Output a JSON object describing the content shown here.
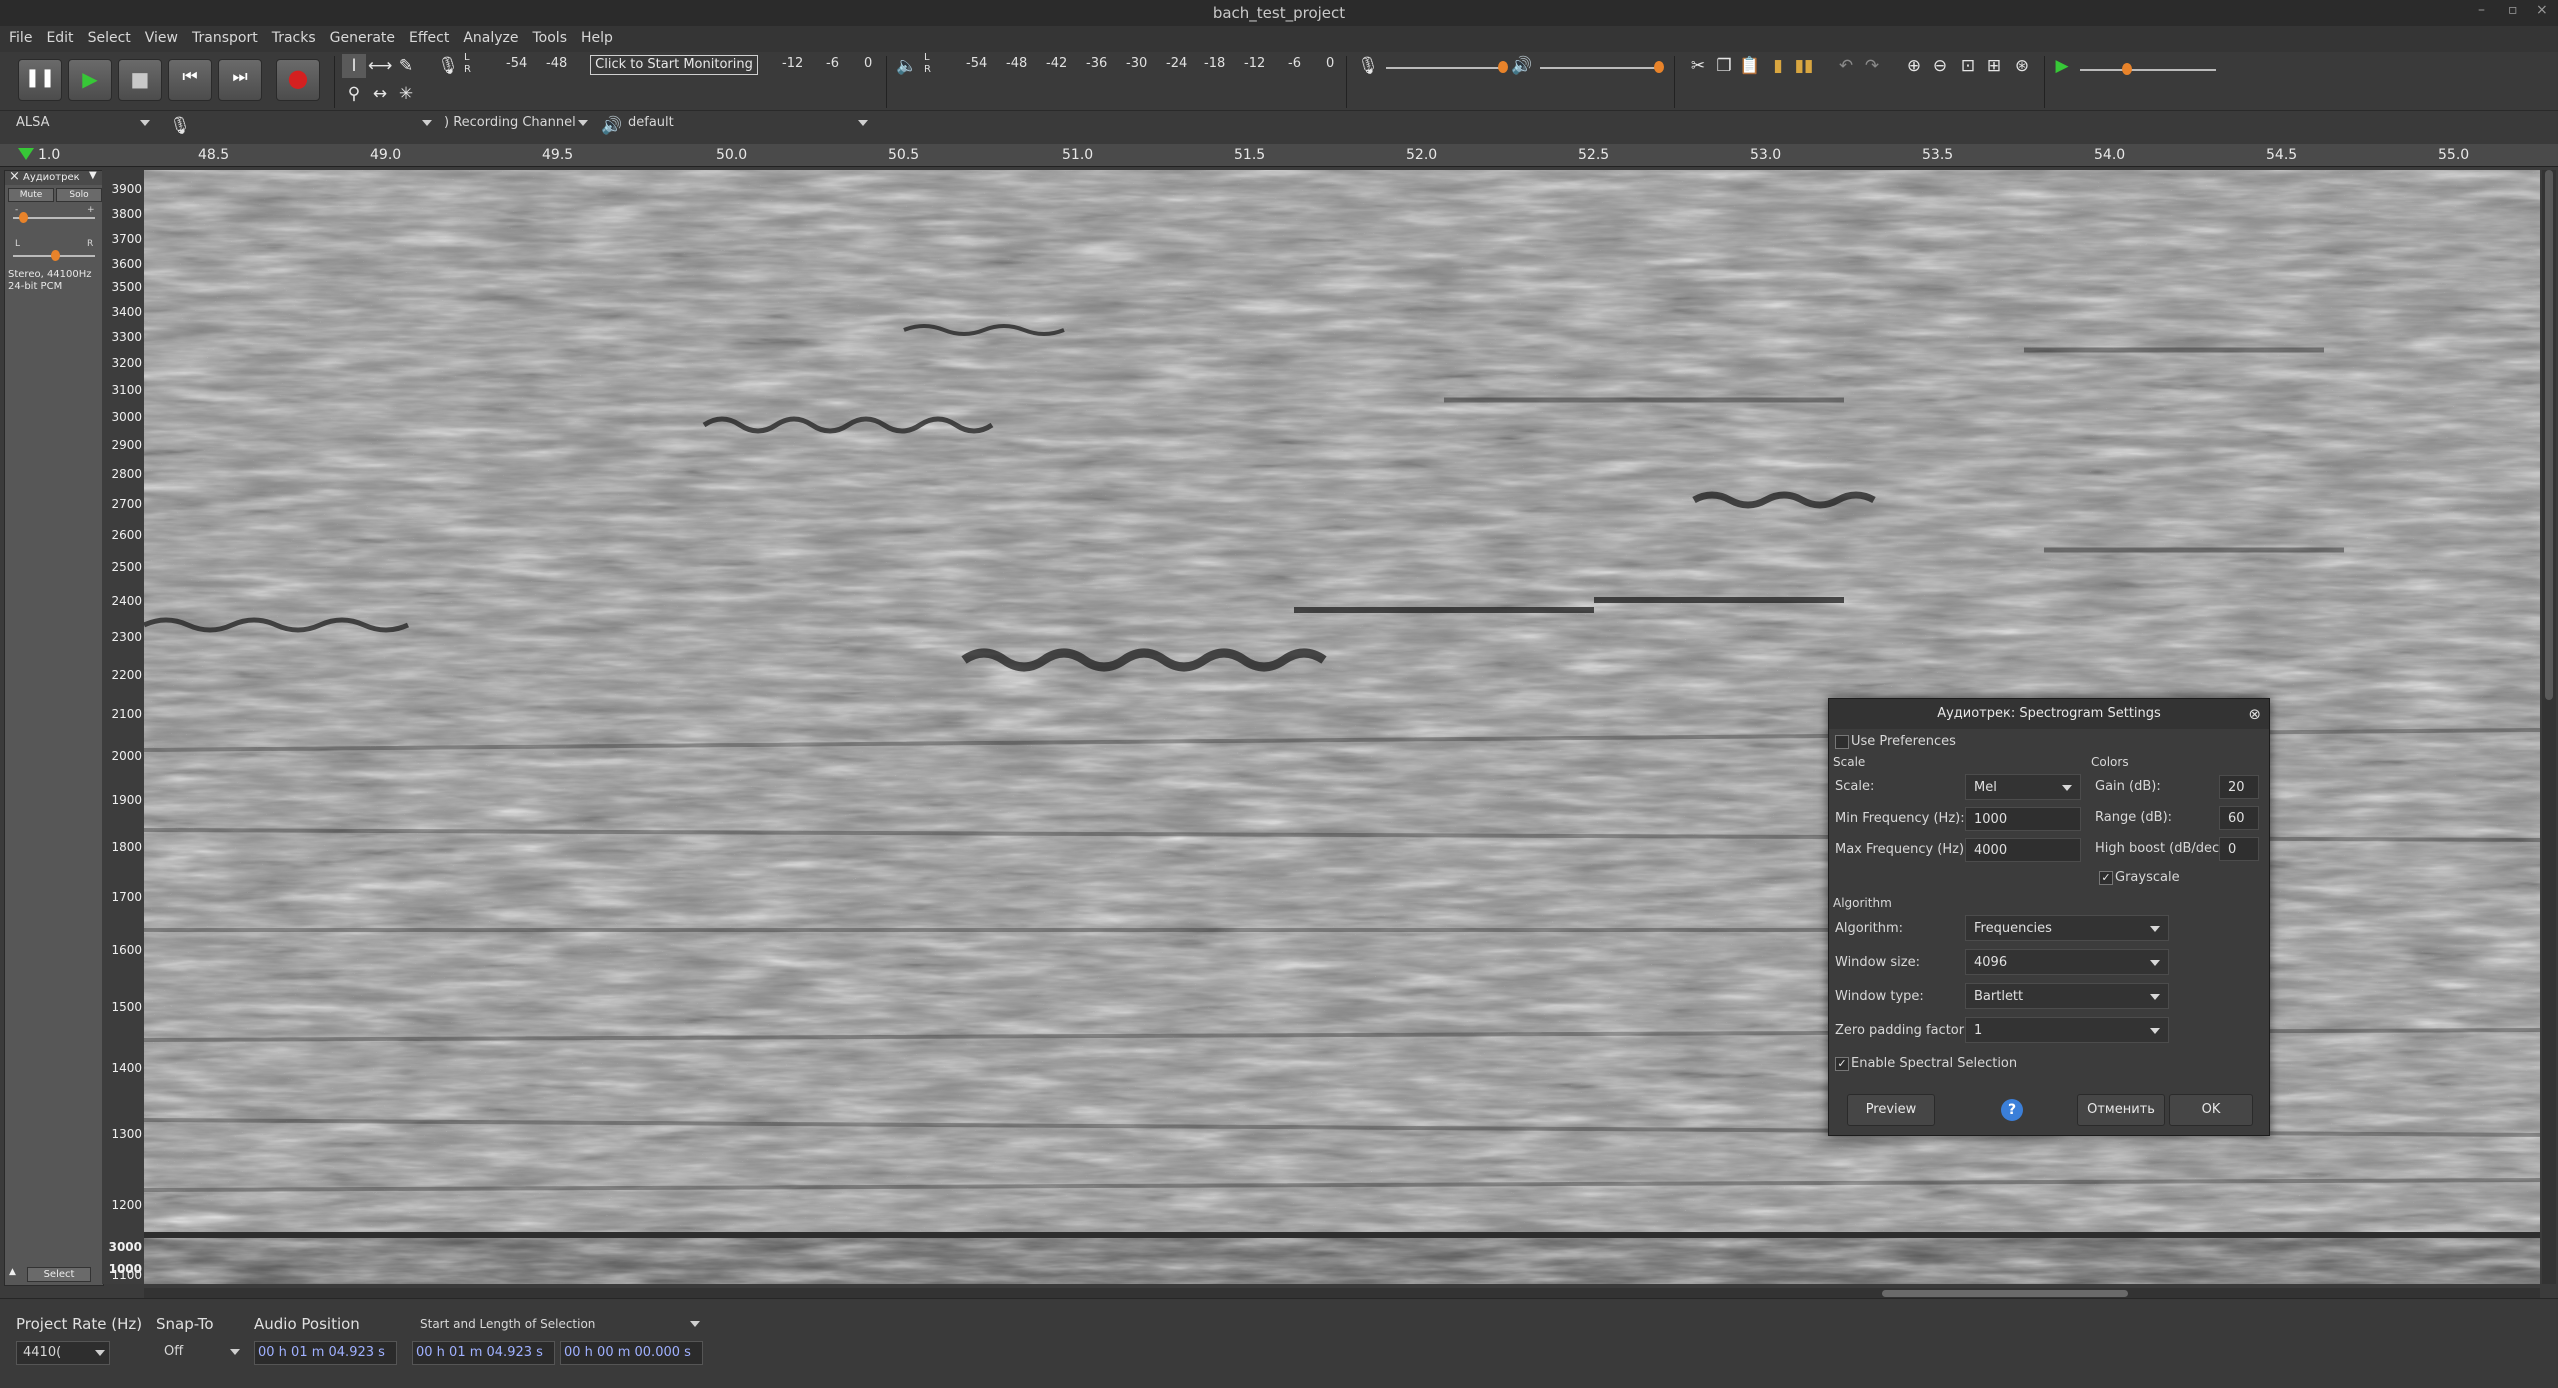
{
  "window": {
    "title": "bach_test_project"
  },
  "menu": [
    "File",
    "Edit",
    "Select",
    "View",
    "Transport",
    "Tracks",
    "Generate",
    "Effect",
    "Analyze",
    "Tools",
    "Help"
  ],
  "meters": {
    "record_scale": [
      "-54",
      "-48",
      "",
      "",
      "",
      "",
      "-12",
      "-6",
      "0"
    ],
    "record_hint": "Click to Start Monitoring",
    "record_l": "L",
    "record_r": "R",
    "play_scale": [
      "-54",
      "-48",
      "-42",
      "-36",
      "-30",
      "-24",
      "-18",
      "-12",
      "-6",
      "0"
    ],
    "play_l": "L",
    "play_r": "R"
  },
  "device_toolbar": {
    "host": "ALSA",
    "recording_channel": ") Recording Channel",
    "playback_device": "default"
  },
  "ruler": {
    "labels": [
      "1.0",
      "48.5",
      "49.0",
      "49.5",
      "50.0",
      "50.5",
      "51.0",
      "51.5",
      "52.0",
      "52.5",
      "53.0",
      "53.5",
      "54.0",
      "54.5",
      "55.0"
    ]
  },
  "track": {
    "name": "Аудиотрек",
    "mute": "Mute",
    "solo": "Solo",
    "gain_minus": "-",
    "gain_plus": "+",
    "pan_l": "L",
    "pan_r": "R",
    "info_line1": "Stereo, 44100Hz",
    "info_line2": "24-bit PCM",
    "select": "Select"
  },
  "freq_axis": {
    "labels": [
      "3900",
      "3800",
      "3700",
      "3600",
      "3500",
      "3400",
      "3300",
      "3200",
      "3100",
      "3000",
      "2900",
      "2800",
      "2700",
      "2600",
      "2500",
      "2400",
      "2300",
      "2200",
      "2100",
      "2000",
      "1900",
      "1800",
      "1700",
      "1600",
      "1500",
      "1400",
      "1300",
      "1200",
      "1100",
      "1000"
    ],
    "lower_labels": [
      "3000",
      "1000"
    ]
  },
  "selection_toolbar": {
    "project_rate_label": "Project Rate (Hz)",
    "project_rate_value": "4410(",
    "snap_to_label": "Snap-To",
    "snap_to_value": "Off",
    "audio_position_label": "Audio Position",
    "audio_position_value": "00 h 01 m 04.923 s",
    "selection_mode": "Start and Length of Selection",
    "selection_start": "00 h 01 m 04.923 s",
    "selection_length": "00 h 00 m 00.000 s"
  },
  "dialog": {
    "title": "Аудиотрек: Spectrogram Settings",
    "use_preferences": "Use Preferences",
    "use_preferences_checked": false,
    "scale_section": "Scale",
    "scale_label": "Scale:",
    "scale_value": "Mel",
    "min_freq_label": "Min Frequency (Hz):",
    "min_freq_value": "1000",
    "max_freq_label": "Max Frequency (Hz):",
    "max_freq_value": "4000",
    "colors_section": "Colors",
    "gain_label": "Gain (dB):",
    "gain_value": "20",
    "range_label": "Range (dB):",
    "range_value": "60",
    "high_boost_label": "High boost (dB/dec):",
    "high_boost_value": "0",
    "grayscale_label": "Grayscale",
    "grayscale_checked": true,
    "algorithm_section": "Algorithm",
    "algorithm_label": "Algorithm:",
    "algorithm_value": "Frequencies",
    "window_size_label": "Window size:",
    "window_size_value": "4096",
    "window_type_label": "Window type:",
    "window_type_value": "Bartlett",
    "zero_padding_label": "Zero padding factor:",
    "zero_padding_value": "1",
    "spectral_selection_label": "Enable Spectral Selection",
    "spectral_selection_checked": true,
    "preview_button": "Preview",
    "help_button": "?",
    "cancel_button": "Отменить",
    "ok_button": "OK"
  },
  "colors": {
    "accent": "#e8832a",
    "play_green": "#37c837",
    "record_red": "#d42020"
  }
}
